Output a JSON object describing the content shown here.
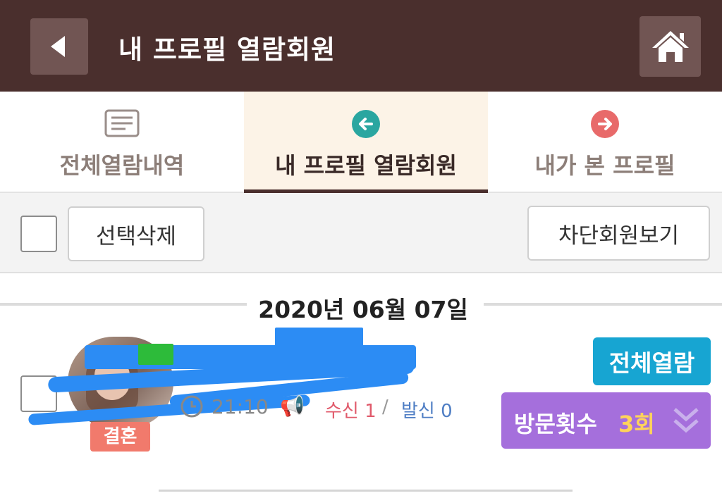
{
  "header": {
    "title": "내 프로필 열람회원",
    "back_icon": "back-arrow-icon",
    "home_icon": "home-icon"
  },
  "tabs": [
    {
      "label": "전체열람내역",
      "icon": "list-icon",
      "active": false
    },
    {
      "label": "내 프로필 열람회원",
      "icon": "arrow-left-circle-icon",
      "active": true,
      "color": "#2aa6a0"
    },
    {
      "label": "내가 본 프로필",
      "icon": "arrow-right-circle-icon",
      "active": false,
      "color": "#e86a6a"
    }
  ],
  "actions": {
    "delete_selected": "선택삭제",
    "view_blocked": "차단회원보기"
  },
  "list": {
    "date": "2020년 06월 07일",
    "items": [
      {
        "status_badge": "결혼",
        "time": "21:10",
        "received_label": "수신",
        "received_count": "1",
        "separator": "/",
        "sent_label": "발신",
        "sent_count": "0",
        "view_all_label": "전체열람",
        "visit_label": "방문횟수",
        "visit_count": "3회"
      }
    ]
  },
  "colors": {
    "header_bg": "#4a2f2d",
    "active_tab_bg": "#fcf3e7",
    "view_all_bg": "#17a5d2",
    "visit_bg": "#a56fdc",
    "visit_count": "#ffd35a"
  }
}
